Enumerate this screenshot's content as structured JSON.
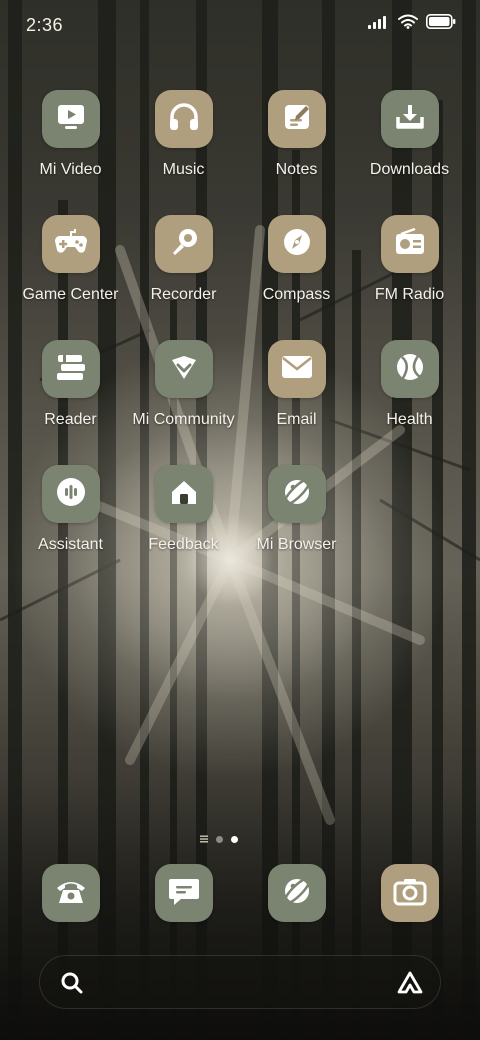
{
  "status_bar": {
    "time": "2:36",
    "icons": [
      "signal-icon",
      "wifi-icon",
      "battery-icon"
    ]
  },
  "apps": [
    {
      "label": "Mi Video",
      "icon": "play-icon",
      "color": "#7a8470"
    },
    {
      "label": "Music",
      "icon": "headphones-icon",
      "color": "#b09f7e"
    },
    {
      "label": "Notes",
      "icon": "notes-icon",
      "color": "#b09f7e"
    },
    {
      "label": "Downloads",
      "icon": "download-icon",
      "color": "#7a8470"
    },
    {
      "label": "Game Center",
      "icon": "gamepad-icon",
      "color": "#b09f7e"
    },
    {
      "label": "Recorder",
      "icon": "microphone-icon",
      "color": "#b09f7e"
    },
    {
      "label": "Compass",
      "icon": "compass-icon",
      "color": "#b09f7e"
    },
    {
      "label": "FM Radio",
      "icon": "radio-icon",
      "color": "#b09f7e"
    },
    {
      "label": "Reader",
      "icon": "books-icon",
      "color": "#7a8470"
    },
    {
      "label": "Mi Community",
      "icon": "chevron-icon",
      "color": "#7a8470"
    },
    {
      "label": "Email",
      "icon": "envelope-icon",
      "color": "#b09f7e"
    },
    {
      "label": "Health",
      "icon": "ball-icon",
      "color": "#7a8470"
    },
    {
      "label": "Assistant",
      "icon": "voice-icon",
      "color": "#7a8470"
    },
    {
      "label": "Feedback",
      "icon": "home-icon",
      "color": "#7a8470"
    },
    {
      "label": "Mi Browser",
      "icon": "planet-icon",
      "color": "#7a8470"
    }
  ],
  "dock": [
    {
      "icon": "phone-icon",
      "color": "#7a8470"
    },
    {
      "icon": "message-icon",
      "color": "#7a8470"
    },
    {
      "icon": "planet-icon",
      "color": "#7a8470"
    },
    {
      "icon": "camera-icon",
      "color": "#b09f7e"
    }
  ],
  "page_indicator": {
    "pages": 2,
    "current": 2
  },
  "search": {
    "left_icon": "search-icon",
    "right_icon": "assistant-a-icon"
  }
}
